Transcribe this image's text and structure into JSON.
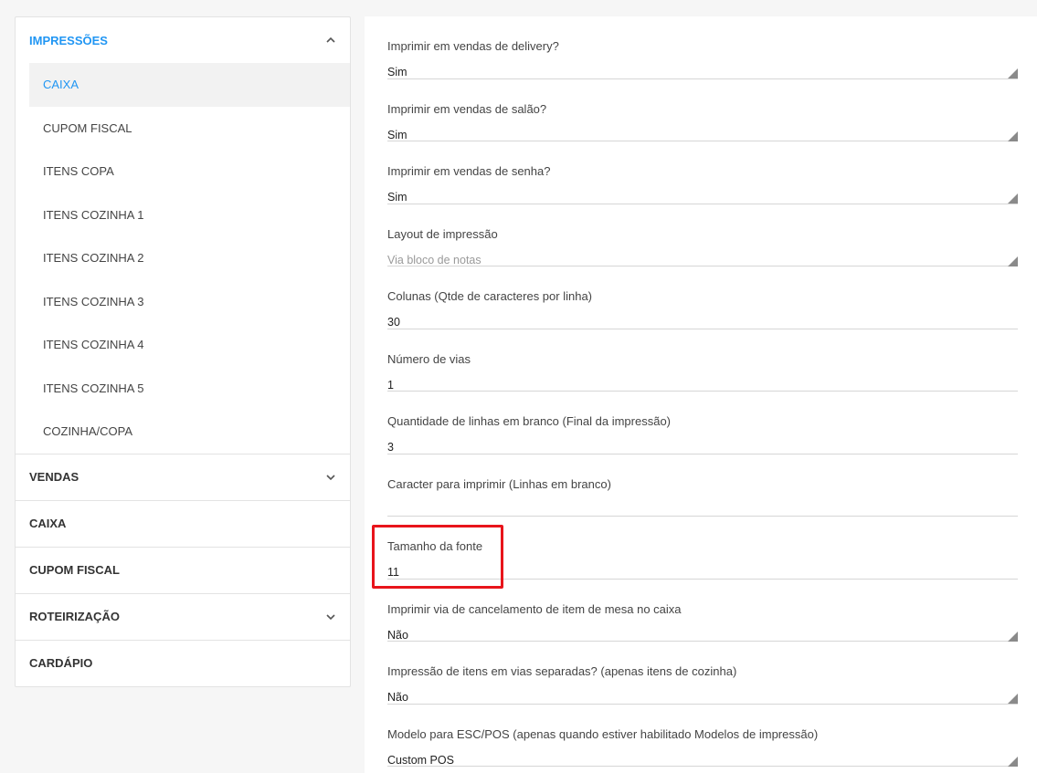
{
  "sidebar": {
    "sections": [
      {
        "label": "IMPRESSÕES",
        "expanded": true,
        "items": [
          {
            "label": "CAIXA",
            "active": true
          },
          {
            "label": "CUPOM FISCAL"
          },
          {
            "label": "ITENS COPA"
          },
          {
            "label": "ITENS COZINHA 1"
          },
          {
            "label": "ITENS COZINHA 2"
          },
          {
            "label": "ITENS COZINHA 3"
          },
          {
            "label": "ITENS COZINHA 4"
          },
          {
            "label": "ITENS COZINHA 5"
          },
          {
            "label": "COZINHA/COPA"
          }
        ]
      },
      {
        "label": "VENDAS",
        "expandable": true
      },
      {
        "label": "CAIXA"
      },
      {
        "label": "CUPOM FISCAL"
      },
      {
        "label": "ROTEIRIZAÇÃO",
        "expandable": true
      },
      {
        "label": "CARDÁPIO"
      }
    ]
  },
  "form": {
    "fields": [
      {
        "label": "Imprimir em vendas de delivery?",
        "value": "Sim",
        "type": "select"
      },
      {
        "label": "Imprimir em vendas de salão?",
        "value": "Sim",
        "type": "select"
      },
      {
        "label": "Imprimir em vendas de senha?",
        "value": "Sim",
        "type": "select"
      },
      {
        "label": "Layout de impressão",
        "value": "Via bloco de notas",
        "type": "select",
        "placeholder": true
      },
      {
        "label": "Colunas (Qtde de caracteres por linha)",
        "value": "30",
        "type": "input"
      },
      {
        "label": "Número de vias",
        "value": "1",
        "type": "input"
      },
      {
        "label": "Quantidade de linhas em branco (Final da impressão)",
        "value": "3",
        "type": "input"
      },
      {
        "label": "Caracter para imprimir (Linhas em branco)",
        "value": "",
        "type": "input"
      },
      {
        "label": "Tamanho da fonte",
        "value": "11",
        "type": "input"
      },
      {
        "label": "Imprimir via de cancelamento de item de mesa no caixa",
        "value": "Não",
        "type": "select"
      },
      {
        "label": "Impressão de itens em vias separadas? (apenas itens de cozinha)",
        "value": "Não",
        "type": "select"
      },
      {
        "label": "Modelo para ESC/POS (apenas quando estiver habilitado Modelos de impressão)",
        "value": "Custom POS",
        "type": "select"
      }
    ]
  },
  "colors": {
    "accent": "#2196f3",
    "highlight": "#e8141b"
  },
  "icons": {
    "chevron_up": "chevron-up-icon",
    "chevron_down": "chevron-down-icon",
    "select_caret": "select-caret-icon"
  }
}
